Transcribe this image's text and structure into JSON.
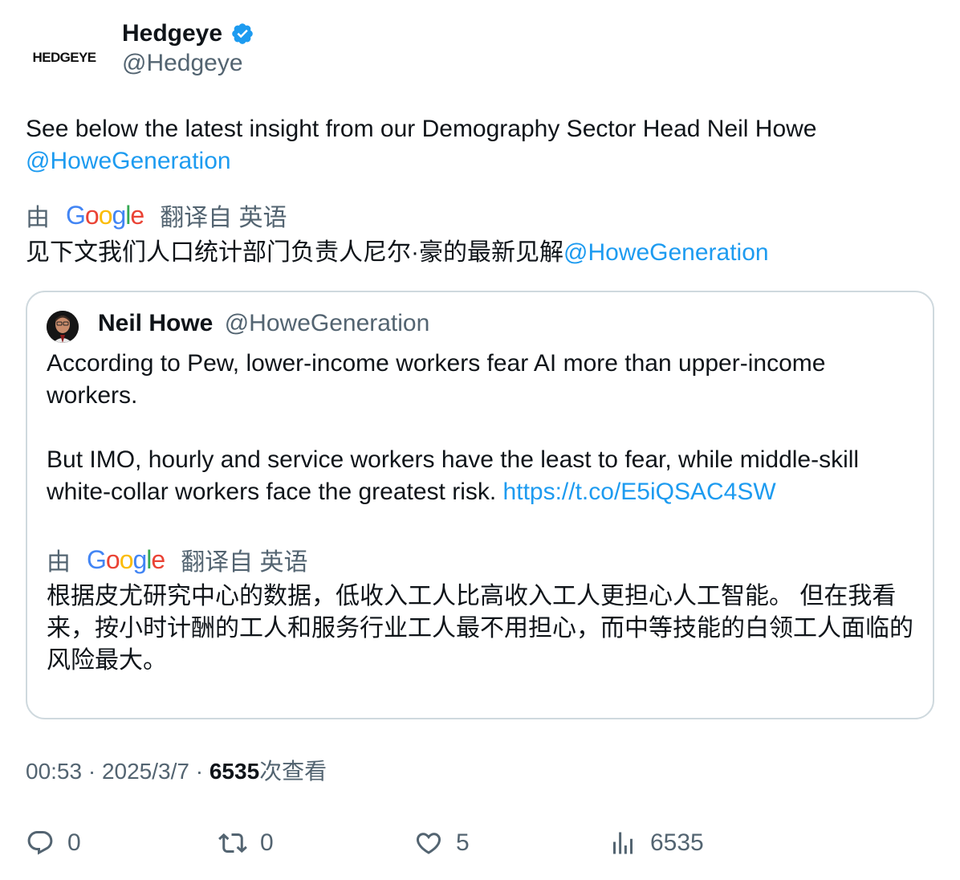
{
  "author": {
    "logo_text": "HEDGEYE",
    "display_name": "Hedgeye",
    "handle": "@Hedgeye",
    "verified_icon": "verified-badge-icon",
    "verified_color": "#1d9bf0"
  },
  "tweet": {
    "text": "See below the latest insight from our Demography Sector Head Neil Howe",
    "mention": "@HoweGeneration",
    "translation_prefix": "由",
    "translation_suffix": "翻译自 英语",
    "translated_text": "见下文我们人口统计部门负责人尼尔·豪的最新见解",
    "translated_mention": "@HoweGeneration"
  },
  "quoted": {
    "display_name": "Neil Howe",
    "handle": "@HoweGeneration",
    "paragraph1": "According to Pew, lower-income workers fear AI more than upper-income workers.",
    "paragraph2": "But IMO, hourly and service workers have the least to fear, while middle-skill white-collar workers face the greatest risk.",
    "link": "https://t.co/E5iQSAC4SW",
    "translation_prefix": "由",
    "translation_suffix": "翻译自 英语",
    "translated_text": "根据皮尤研究中心的数据，低收入工人比高收入工人更担心人工智能。 但在我看来，按小时计酬的工人和服务行业工人最不用担心，而中等技能的白领工人面临的风险最大。"
  },
  "meta": {
    "time": "00:53",
    "sep1": " · ",
    "date": "2025/3/7",
    "sep2": " · ",
    "views": "6535",
    "views_suffix": "次查看"
  },
  "google_brand": {
    "letters": [
      "G",
      "o",
      "o",
      "g",
      "l",
      "e"
    ],
    "colors": [
      "#4285f4",
      "#ea4335",
      "#fbbc05",
      "#4285f4",
      "#34a853",
      "#ea4335"
    ]
  },
  "actions": {
    "replies": "0",
    "retweets": "0",
    "likes": "5",
    "views": "6535"
  },
  "colors": {
    "link": "#1d9bf0",
    "secondary_text": "#536471",
    "border": "#cfd9de"
  }
}
